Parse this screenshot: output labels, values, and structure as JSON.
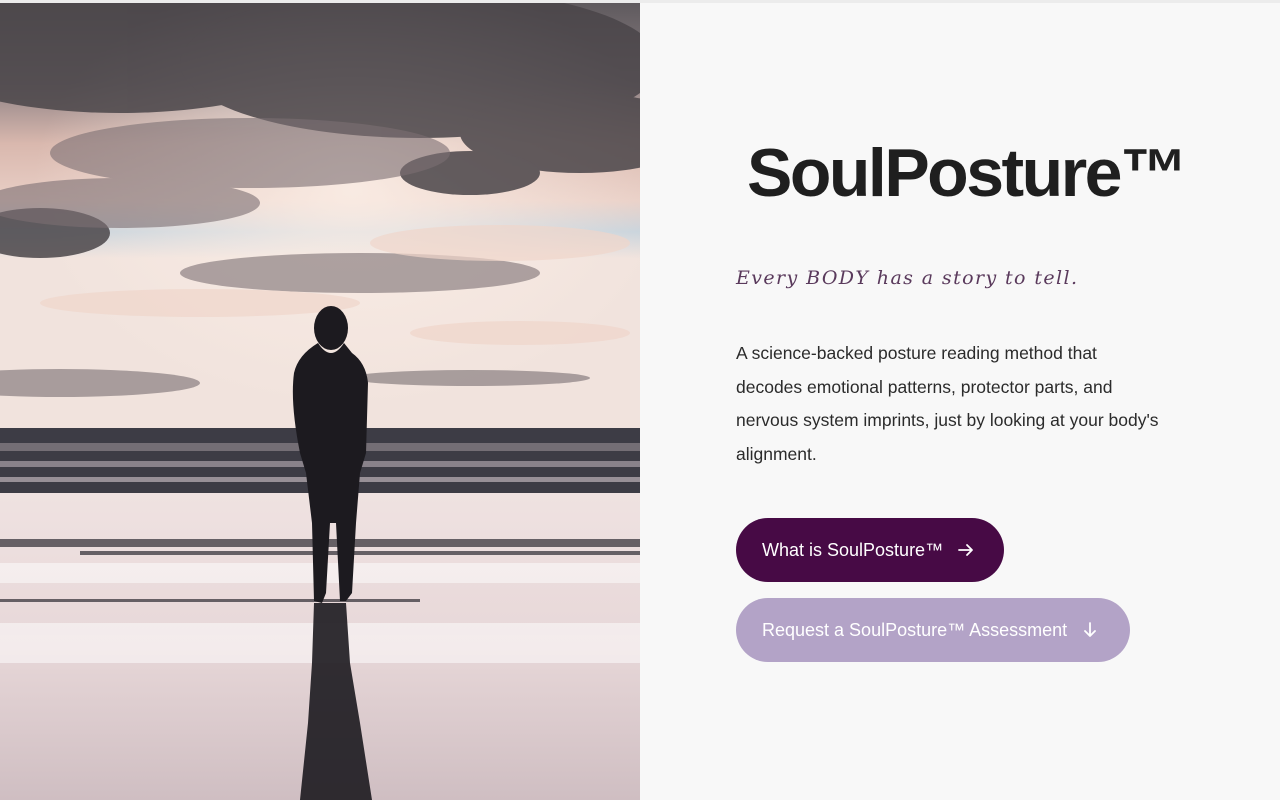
{
  "hero": {
    "image_alt": "Silhouette of a woman standing on a beach at sunset",
    "colors": {
      "sky_top": "#6b6568",
      "sky_glow": "#e9c9bf",
      "sky_blue": "#c9d6e0",
      "horizon": "#f2e2dc",
      "sea": "#3c3c44",
      "sand": "#e4d6d8",
      "silhouette": "#1c1a1f"
    }
  },
  "brand": {
    "title": "SoulPosture™",
    "text_color": "#1f1f1f"
  },
  "tagline": "Every BODY has a story to tell.",
  "description": "A science-backed posture reading method that decodes emotional patterns, protector parts, and nervous system imprints, just by looking at your body's alignment.",
  "buttons": {
    "primary": {
      "label": "What is SoulPosture™",
      "icon": "arrow-right-icon",
      "color": "#470a45"
    },
    "secondary": {
      "label": "Request a SoulPosture™ Assessment",
      "icon": "arrow-down-icon",
      "color": "#b3a3c7"
    }
  }
}
